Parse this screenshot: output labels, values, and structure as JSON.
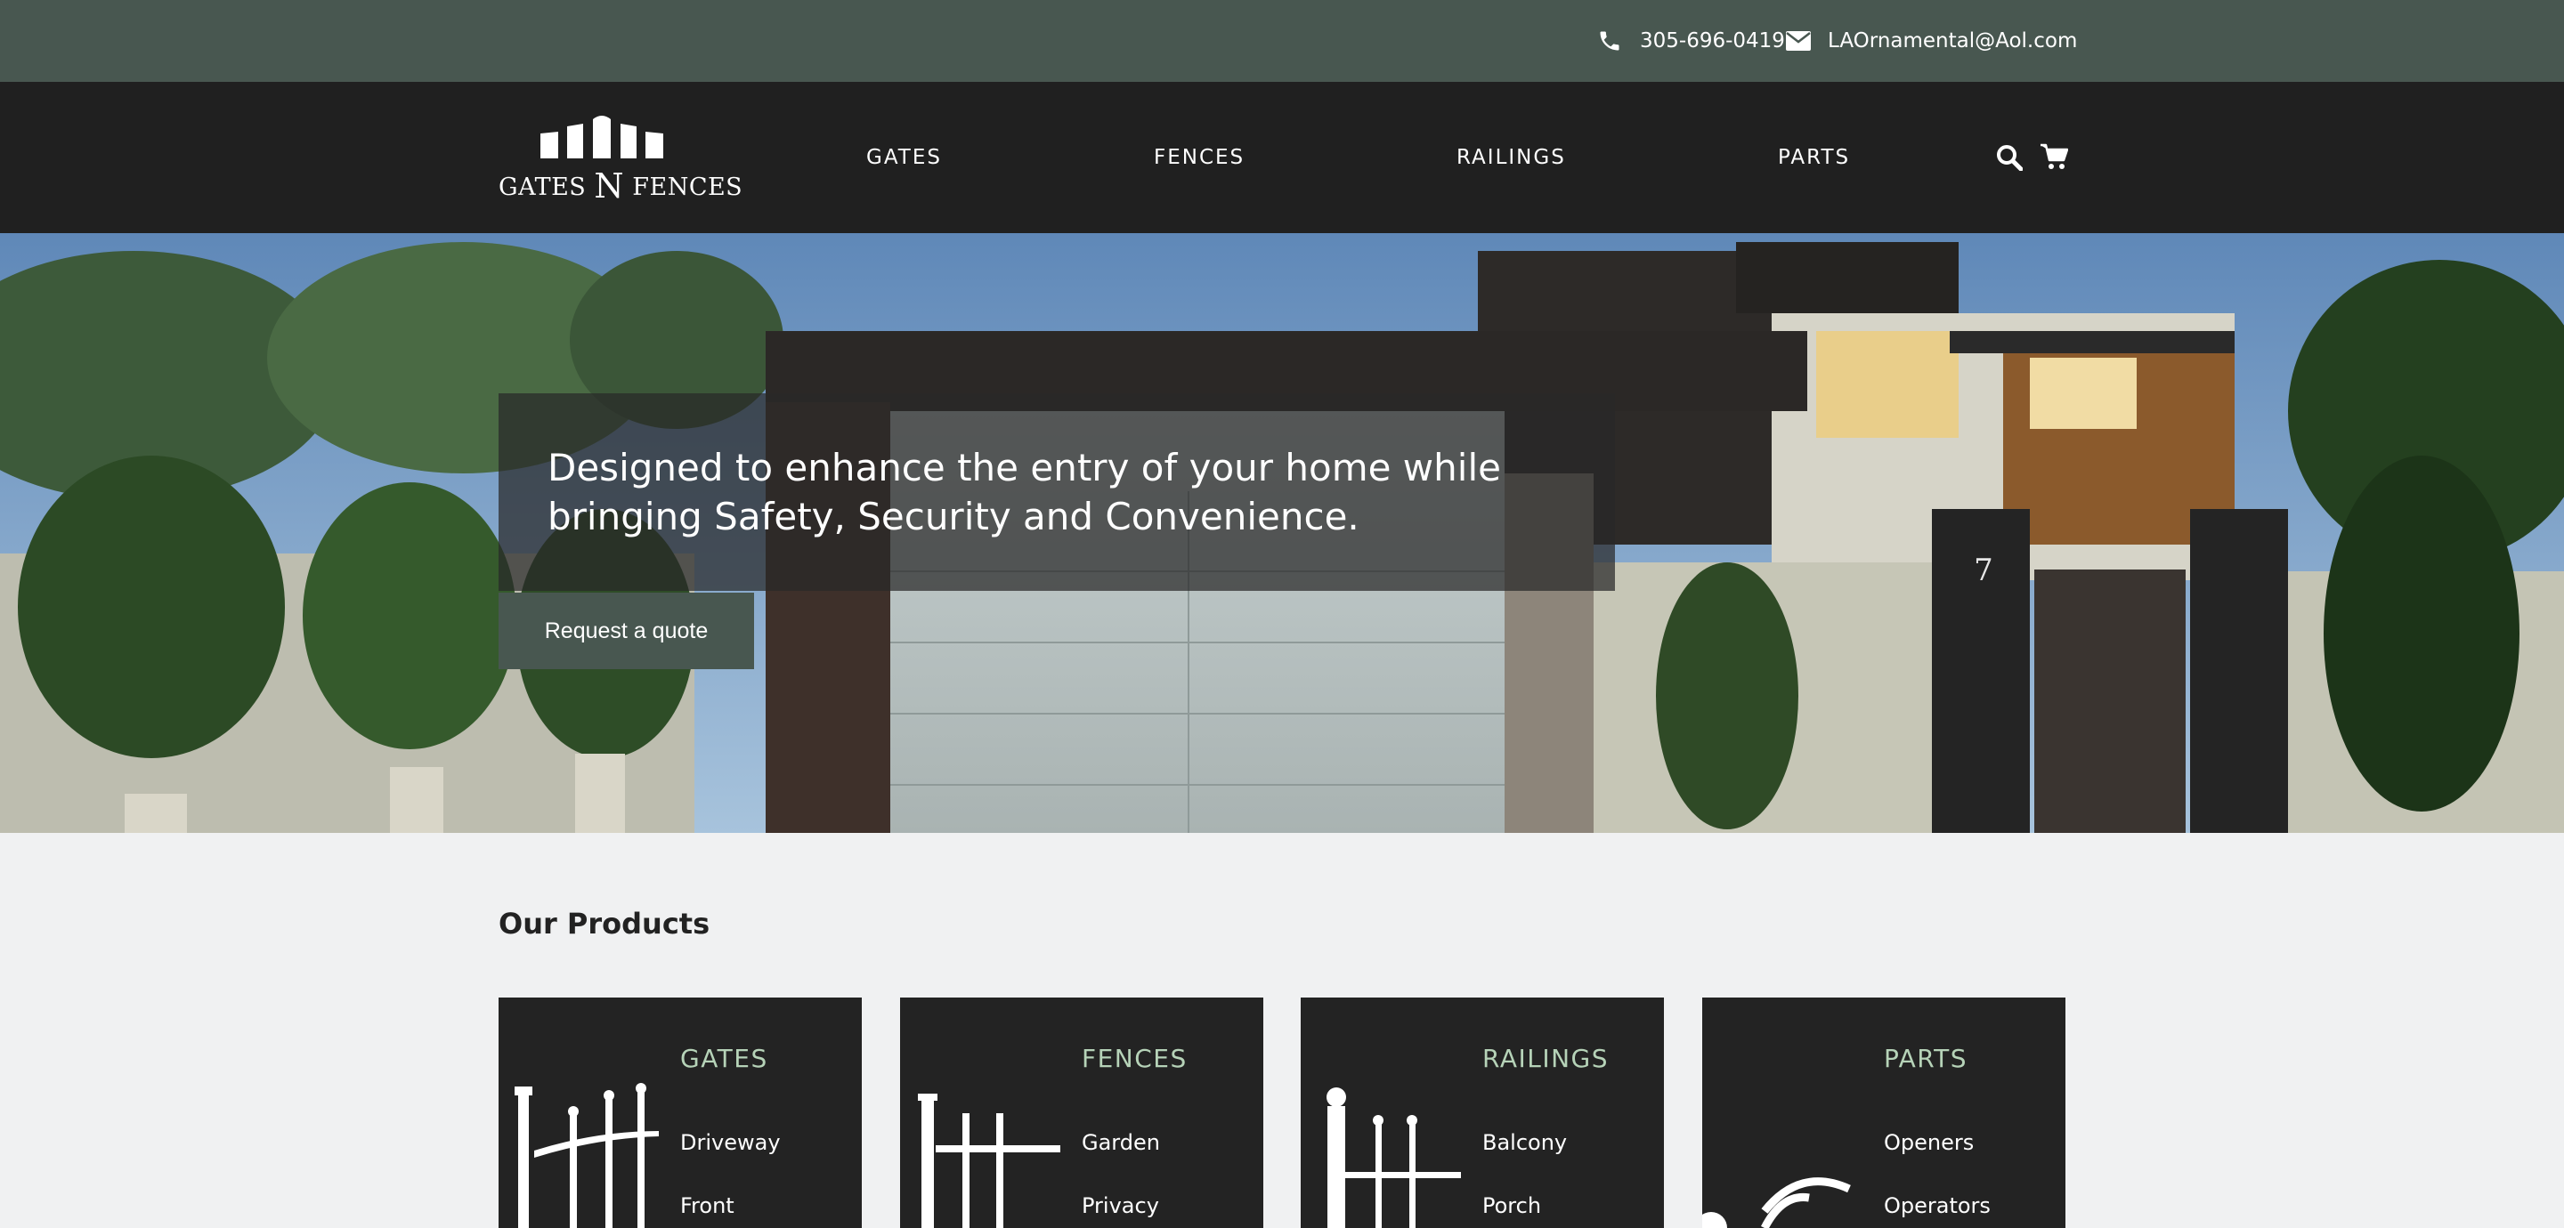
{
  "topbar": {
    "phone": "305-696-0419",
    "email": "LAOrnamental@Aol.com",
    "icons": [
      "phone-icon",
      "envelope-icon"
    ]
  },
  "navbar": {
    "logo_text_left": "GATES",
    "logo_text_n": "N",
    "logo_text_right": "FENCES",
    "links": [
      "GATES",
      "FENCES",
      "RAILINGS",
      "PARTS"
    ],
    "icons": [
      "search-icon",
      "cart-icon"
    ]
  },
  "hero": {
    "heading": "Designed to enhance the entry of your home while bringing Safety, Security and Convenience.",
    "button_label": "Request a quote",
    "house_number": "7"
  },
  "products": {
    "title": "Our Products",
    "cards": [
      {
        "title": "GATES",
        "items": [
          "Driveway",
          "Front"
        ]
      },
      {
        "title": "FENCES",
        "items": [
          "Garden",
          "Privacy"
        ]
      },
      {
        "title": "RAILINGS",
        "items": [
          "Balcony",
          "Porch"
        ]
      },
      {
        "title": "PARTS",
        "items": [
          "Openers",
          "Operators"
        ]
      }
    ]
  },
  "colors": {
    "topbar": "#485750",
    "navbar": "#202020",
    "card_bg": "#232323",
    "card_title": "#b6d3b8",
    "page_bg": "#f0f1f2"
  }
}
